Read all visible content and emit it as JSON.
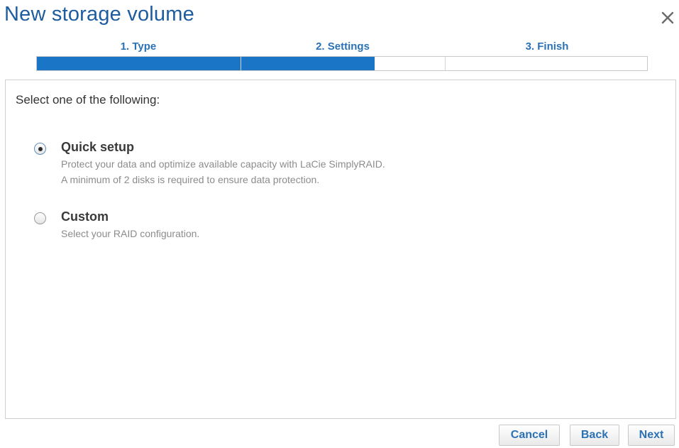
{
  "dialog": {
    "title": "New storage volume",
    "close_icon": "close-icon"
  },
  "steps": [
    {
      "label": "1. Type"
    },
    {
      "label": "2. Settings"
    },
    {
      "label": "3. Finish"
    }
  ],
  "progress": {
    "completed_fraction": 0.553,
    "fill_color": "#1b75c6"
  },
  "content": {
    "prompt": "Select one of the following:",
    "options": [
      {
        "title": "Quick setup",
        "selected": true,
        "desc_line1": "Protect your data and optimize available capacity with LaCie SimplyRAID.",
        "desc_line2": "A minimum of 2 disks is required to ensure data protection."
      },
      {
        "title": "Custom",
        "selected": false,
        "desc_line1": "Select your RAID configuration."
      }
    ]
  },
  "footer": {
    "cancel_label": "Cancel",
    "back_label": "Back",
    "next_label": "Next"
  },
  "colors": {
    "title": "#1d5c9e",
    "accent": "#2a72b5"
  }
}
